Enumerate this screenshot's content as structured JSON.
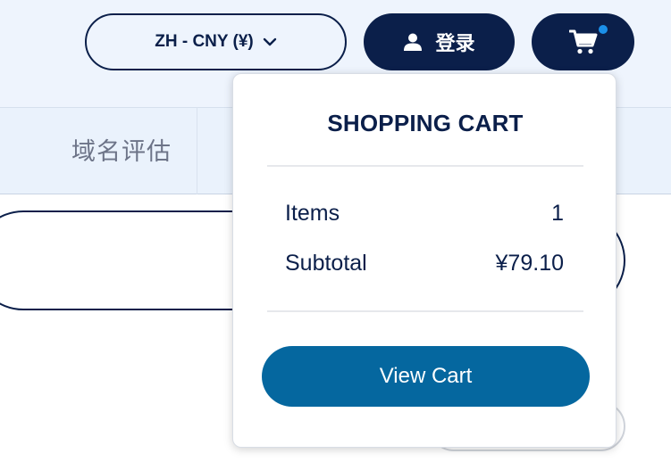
{
  "header": {
    "language_currency": "ZH - CNY (¥)",
    "login_label": "登录",
    "cart_has_items": true
  },
  "subnav": {
    "items": [
      {
        "label": "域名评估"
      }
    ]
  },
  "cart_dropdown": {
    "title": "SHOPPING CART",
    "items_label": "Items",
    "items_value": "1",
    "subtotal_label": "Subtotal",
    "subtotal_value": "¥79.10",
    "view_cart_label": "View Cart"
  },
  "icons": {
    "language": "chevron-down-icon",
    "login": "user-icon",
    "cart": "cart-icon"
  },
  "colors": {
    "navy": "#0b1f4a",
    "accent_button": "#05679f",
    "notification_dot": "#1b8fe8",
    "header_bg": "#eef4fd"
  }
}
